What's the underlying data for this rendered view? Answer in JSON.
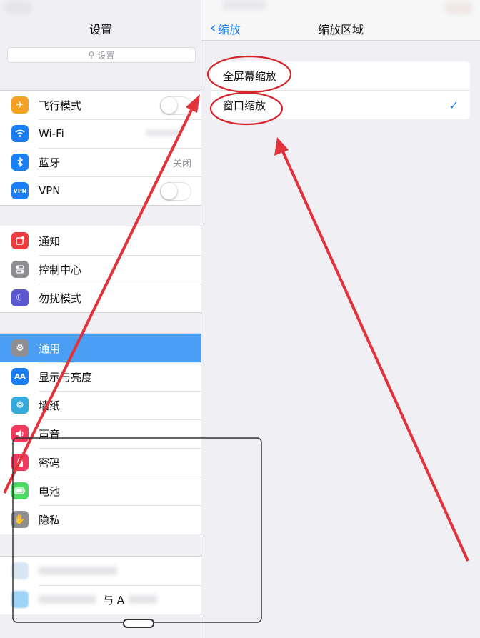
{
  "left_pane": {
    "title": "设置",
    "search_placeholder": "设置",
    "groups": [
      [
        {
          "label": "飞行模式",
          "icon": "airplane-icon",
          "color": "#f4a126",
          "accessory": "switch"
        },
        {
          "label": "Wi-Fi",
          "icon": "wifi-icon",
          "color": "#1a7ff5",
          "accessory": "blurred-value"
        },
        {
          "label": "蓝牙",
          "icon": "bluetooth-icon",
          "color": "#1a7ff5",
          "value": "关闭"
        },
        {
          "label": "VPN",
          "icon": "vpn-icon",
          "color": "#1a7ff5",
          "accessory": "switch"
        }
      ],
      [
        {
          "label": "通知",
          "icon": "notifications-icon",
          "color": "#ed3b3b"
        },
        {
          "label": "控制中心",
          "icon": "control-center-icon",
          "color": "#8e8e93"
        },
        {
          "label": "勿扰模式",
          "icon": "moon-icon",
          "color": "#5b57cf"
        }
      ],
      [
        {
          "label": "通用",
          "icon": "gear-icon",
          "color": "#8e8e93",
          "selected": true
        },
        {
          "label": "显示与亮度",
          "icon": "brightness-icon",
          "color": "#1a7ff5"
        },
        {
          "label": "墙纸",
          "icon": "wallpaper-icon",
          "color": "#34aadc"
        },
        {
          "label": "声音",
          "icon": "sound-icon",
          "color": "#ef3a5d"
        },
        {
          "label": "密码",
          "icon": "lock-icon",
          "color": "#ef3a5d"
        },
        {
          "label": "电池",
          "icon": "battery-icon",
          "color": "#4cd964"
        },
        {
          "label": "隐私",
          "icon": "hand-icon",
          "color": "#8e8e93"
        }
      ],
      [
        {
          "label": "",
          "icon": "blurred-icon",
          "color": "#d7e6f2"
        },
        {
          "label": "与 A",
          "icon": "blurred-icon",
          "color": "#9fd3f5"
        }
      ]
    ]
  },
  "right_pane": {
    "back_label": "缩放",
    "title": "缩放区域",
    "options": [
      {
        "label": "全屏幕缩放",
        "checked": false
      },
      {
        "label": "窗口缩放",
        "checked": true
      }
    ],
    "check_glyph": "✓"
  },
  "annotations": {
    "ellipse_color": "#d6262c",
    "arrow_color": "#e2333a",
    "frame_color": "#333333"
  }
}
